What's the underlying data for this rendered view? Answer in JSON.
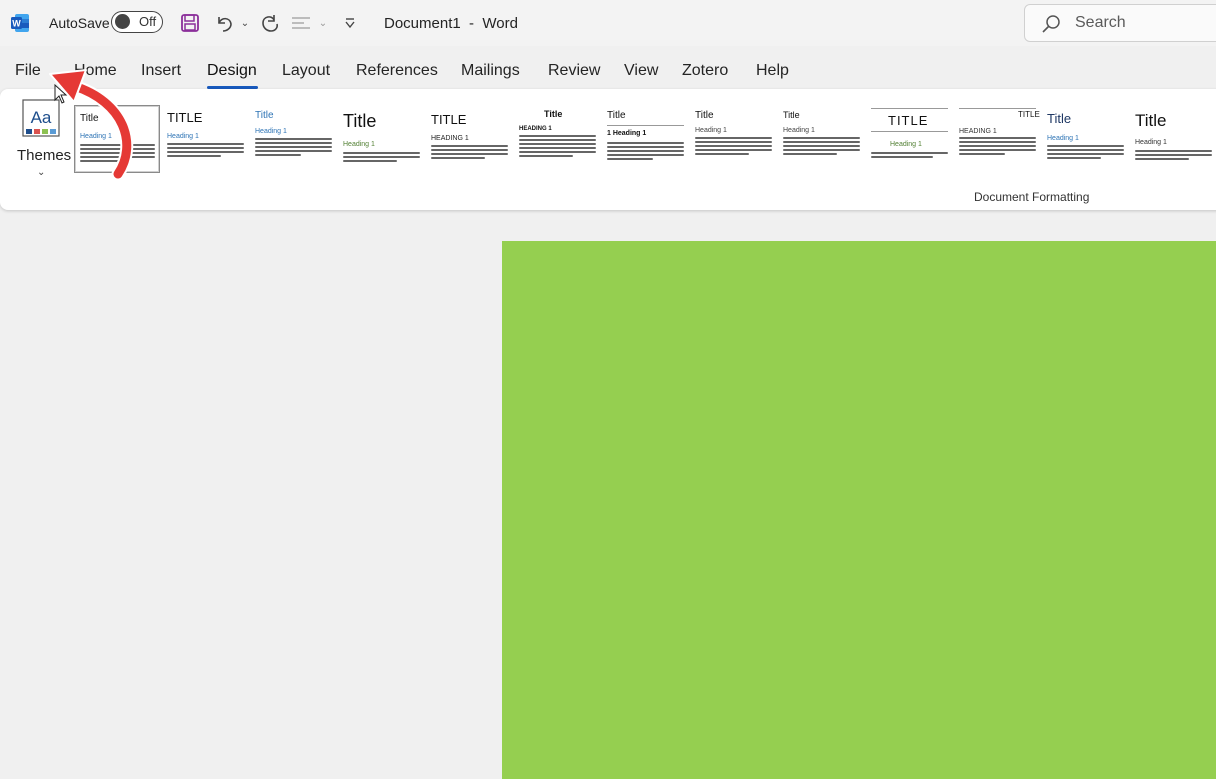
{
  "titlebar": {
    "autosave_label": "AutoSave",
    "autosave_state": "Off",
    "document_name": "Document1  -  Word",
    "search_placeholder": "Search"
  },
  "menu": {
    "tabs": [
      "File",
      "Home",
      "Insert",
      "Design",
      "Layout",
      "References",
      "Mailings",
      "Review",
      "View",
      "Zotero",
      "Help"
    ],
    "active_tab": "Design"
  },
  "ribbon": {
    "themes_label": "Themes",
    "group_label": "Document Formatting",
    "gallery": [
      {
        "title": "Title",
        "heading": "Heading 1"
      },
      {
        "title": "TITLE",
        "heading": "Heading 1"
      },
      {
        "title": "Title",
        "heading": "Heading 1"
      },
      {
        "title": "Title",
        "heading": "Heading 1"
      },
      {
        "title": "TITLE",
        "heading": "HEADING 1"
      },
      {
        "title": "Title",
        "heading": "HEADING 1"
      },
      {
        "title": "Title",
        "heading": "1  Heading 1"
      },
      {
        "title": "Title",
        "heading": "Heading 1"
      },
      {
        "title": "Title",
        "heading": "Heading 1"
      },
      {
        "title": "TITLE",
        "heading": "Heading 1"
      },
      {
        "title": "TITLE",
        "heading": "HEADING 1"
      },
      {
        "title": "Title",
        "heading": "Heading 1"
      },
      {
        "title": "Title",
        "heading": "Heading 1"
      }
    ]
  },
  "colors": {
    "page_fill": "#95cf50",
    "accent": "#185abd",
    "arrow": "#e53935"
  }
}
